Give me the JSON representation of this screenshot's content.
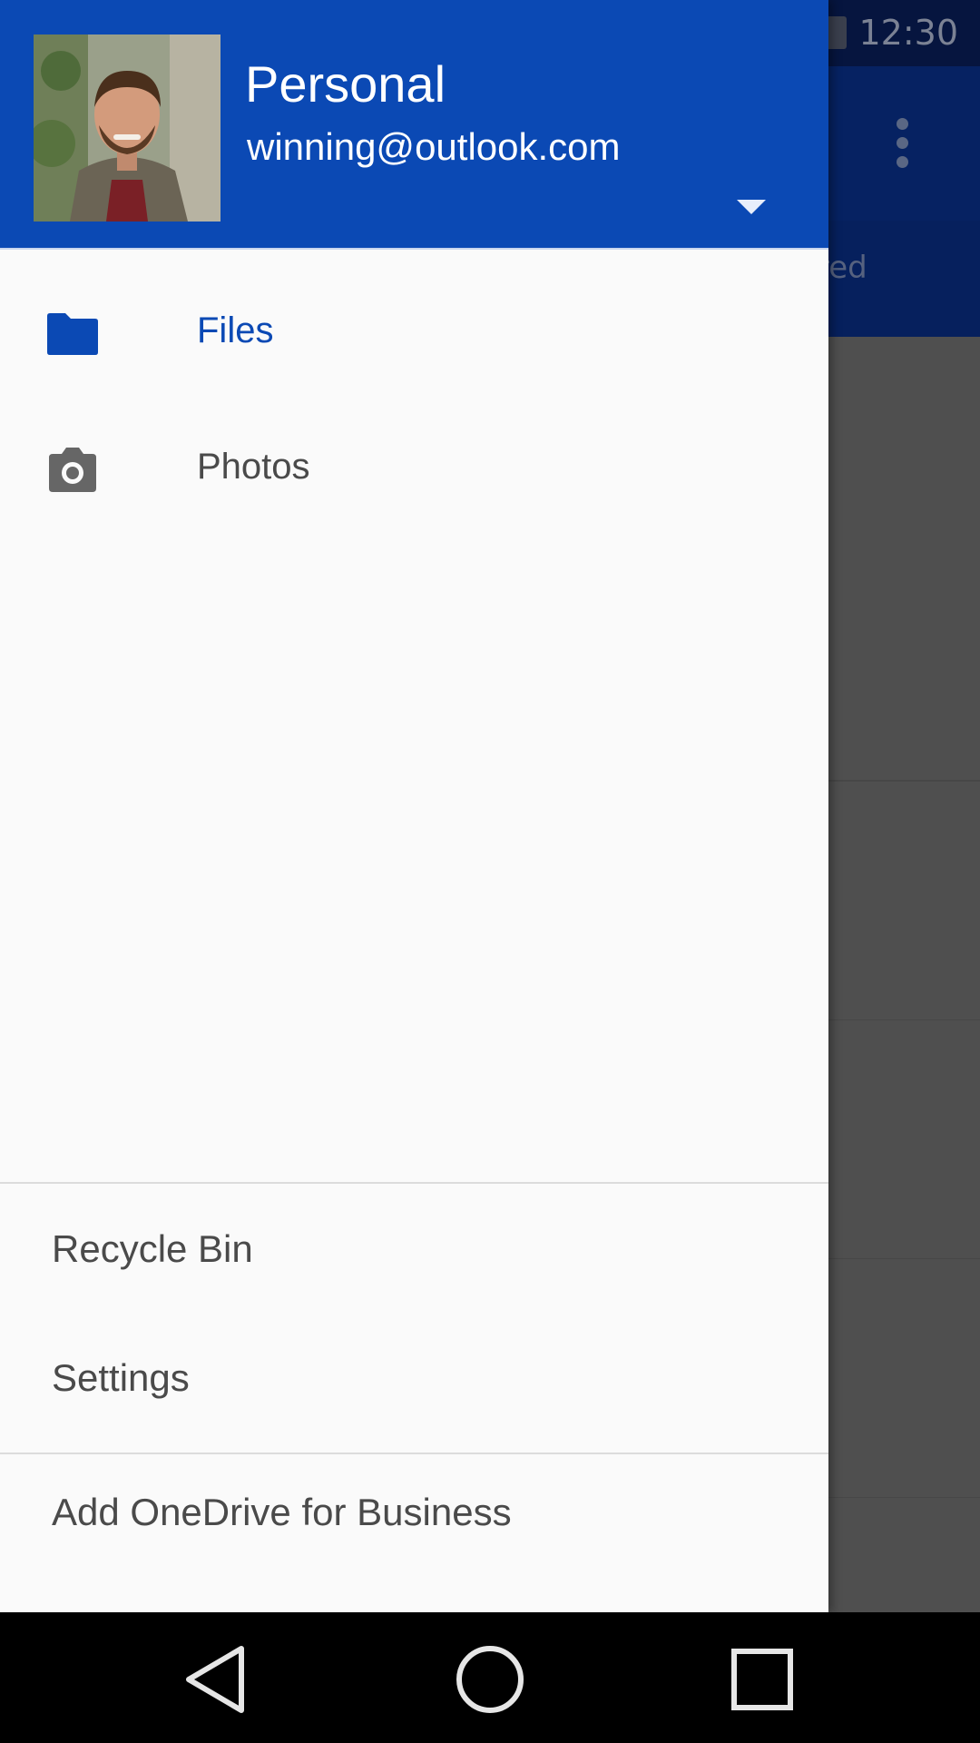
{
  "status_bar": {
    "time": "12:30"
  },
  "background": {
    "tab_shared_fragment": "red"
  },
  "drawer": {
    "account": {
      "name": "Personal",
      "email": "winning@outlook.com"
    },
    "nav_items": [
      {
        "label": "Files",
        "icon": "folder-icon",
        "selected": true
      },
      {
        "label": "Photos",
        "icon": "camera-icon",
        "selected": false
      }
    ],
    "footer_items": [
      {
        "label": "Recycle Bin"
      },
      {
        "label": "Settings"
      },
      {
        "label": "Add OneDrive for Business"
      }
    ]
  },
  "colors": {
    "accent": "#0b49b4",
    "drawer_bg": "#fafafa",
    "text": "#4a4a4a"
  }
}
